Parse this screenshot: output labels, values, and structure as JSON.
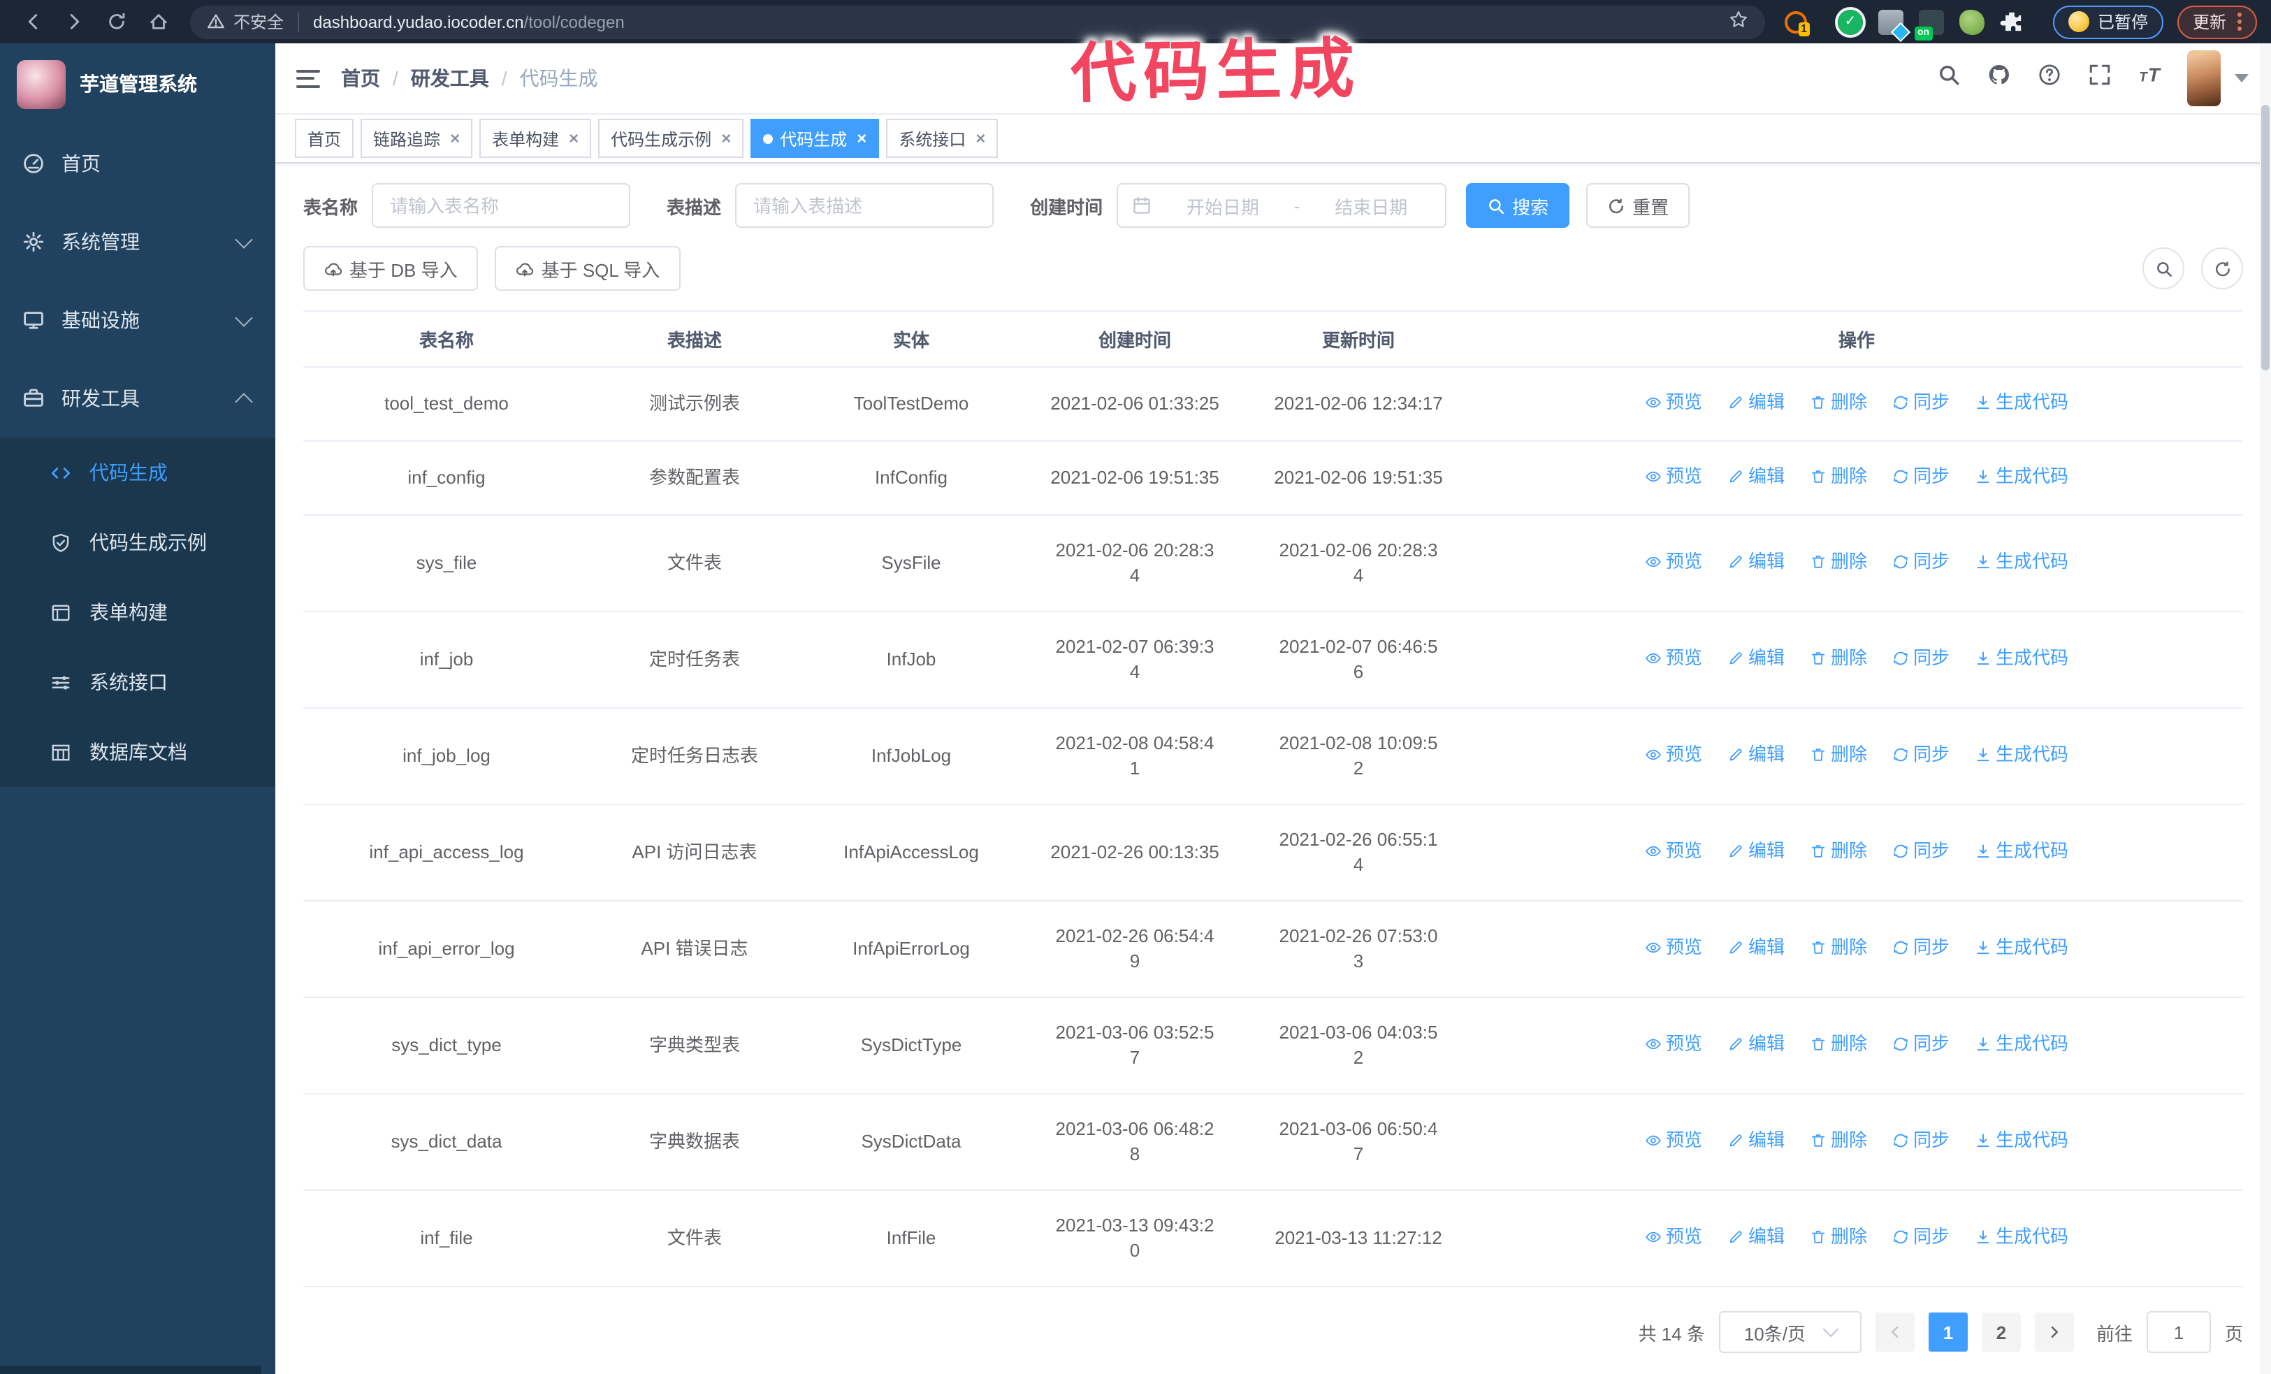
{
  "browser": {
    "security_warning": "不安全",
    "url_host": "dashboard.yudao.iocoder.cn",
    "url_path": "/tool/codegen",
    "extension_count_badge": "1",
    "extension_on_badge": "on",
    "paused_badge_label": "已暂停",
    "update_button_label": "更新"
  },
  "annotation": {
    "text": "代码生成",
    "color": "#f2455f"
  },
  "sidebar": {
    "logo_title": "芋道管理系统",
    "menu": [
      {
        "label": "首页",
        "icon": "dashboard",
        "arrow": null,
        "active": false
      },
      {
        "label": "系统管理",
        "icon": "gear",
        "arrow": "down",
        "active": false
      },
      {
        "label": "基础设施",
        "icon": "monitor",
        "arrow": "down",
        "active": false
      },
      {
        "label": "研发工具",
        "icon": "briefcase",
        "arrow": "up",
        "active": false
      }
    ],
    "submenu": [
      {
        "label": "代码生成",
        "icon": "code",
        "active": true
      },
      {
        "label": "代码生成示例",
        "icon": "shield-check",
        "active": false
      },
      {
        "label": "表单构建",
        "icon": "form",
        "active": false
      },
      {
        "label": "系统接口",
        "icon": "sliders",
        "active": false
      },
      {
        "label": "数据库文档",
        "icon": "db-grid",
        "active": false
      }
    ]
  },
  "navbar": {
    "breadcrumb": [
      {
        "label": "首页",
        "current": false
      },
      {
        "label": "研发工具",
        "current": false
      },
      {
        "label": "代码生成",
        "current": true
      }
    ],
    "right_icons": [
      "search",
      "github",
      "question",
      "fullscreen",
      "text-size"
    ]
  },
  "tabs": [
    {
      "label": "首页",
      "closable": false,
      "active": false
    },
    {
      "label": "链路追踪",
      "closable": true,
      "active": false
    },
    {
      "label": "表单构建",
      "closable": true,
      "active": false
    },
    {
      "label": "代码生成示例",
      "closable": true,
      "active": false
    },
    {
      "label": "代码生成",
      "closable": true,
      "active": true
    },
    {
      "label": "系统接口",
      "closable": true,
      "active": false
    }
  ],
  "filters": {
    "name_label": "表名称",
    "name_placeholder": "请输入表名称",
    "desc_label": "表描述",
    "desc_placeholder": "请输入表描述",
    "time_label": "创建时间",
    "start_placeholder": "开始日期",
    "separator": "-",
    "end_placeholder": "结束日期",
    "search_button": "搜索",
    "reset_button": "重置"
  },
  "actions_bar": {
    "import_db_button": "基于 DB 导入",
    "import_sql_button": "基于 SQL 导入"
  },
  "table": {
    "columns": [
      "表名称",
      "表描述",
      "实体",
      "创建时间",
      "更新时间",
      "操作"
    ],
    "row_actions": [
      {
        "label": "预览",
        "icon": "eye"
      },
      {
        "label": "编辑",
        "icon": "edit"
      },
      {
        "label": "删除",
        "icon": "trash"
      },
      {
        "label": "同步",
        "icon": "sync"
      },
      {
        "label": "生成代码",
        "icon": "download"
      }
    ],
    "rows": [
      {
        "name": "tool_test_demo",
        "desc": "测试示例表",
        "entity": "ToolTestDemo",
        "created": "2021-02-06 01:33:25",
        "updated": "2021-02-06 12:34:17"
      },
      {
        "name": "inf_config",
        "desc": "参数配置表",
        "entity": "InfConfig",
        "created": "2021-02-06 19:51:35",
        "updated": "2021-02-06 19:51:35"
      },
      {
        "name": "sys_file",
        "desc": "文件表",
        "entity": "SysFile",
        "created": "2021-02-06 20:28:3\n4",
        "updated": "2021-02-06 20:28:3\n4"
      },
      {
        "name": "inf_job",
        "desc": "定时任务表",
        "entity": "InfJob",
        "created": "2021-02-07 06:39:3\n4",
        "updated": "2021-02-07 06:46:5\n6"
      },
      {
        "name": "inf_job_log",
        "desc": "定时任务日志表",
        "entity": "InfJobLog",
        "created": "2021-02-08 04:58:4\n1",
        "updated": "2021-02-08 10:09:5\n2"
      },
      {
        "name": "inf_api_access_log",
        "desc": "API 访问日志表",
        "entity": "InfApiAccessLog",
        "created": "2021-02-26 00:13:35",
        "updated": "2021-02-26 06:55:1\n4"
      },
      {
        "name": "inf_api_error_log",
        "desc": "API 错误日志",
        "entity": "InfApiErrorLog",
        "created": "2021-02-26 06:54:4\n9",
        "updated": "2021-02-26 07:53:0\n3"
      },
      {
        "name": "sys_dict_type",
        "desc": "字典类型表",
        "entity": "SysDictType",
        "created": "2021-03-06 03:52:5\n7",
        "updated": "2021-03-06 04:03:5\n2"
      },
      {
        "name": "sys_dict_data",
        "desc": "字典数据表",
        "entity": "SysDictData",
        "created": "2021-03-06 06:48:2\n8",
        "updated": "2021-03-06 06:50:4\n7"
      },
      {
        "name": "inf_file",
        "desc": "文件表",
        "entity": "InfFile",
        "created": "2021-03-13 09:43:2\n0",
        "updated": "2021-03-13 11:27:12"
      }
    ]
  },
  "pagination": {
    "total": "共 14 条",
    "page_size": "10条/页",
    "pages": [
      "1",
      "2"
    ],
    "active_page": "1",
    "goto_label": "前往",
    "goto_value": "1",
    "goto_suffix": "页"
  },
  "colors": {
    "primary": "#409eff",
    "sidebar_bg": "#20425f",
    "submenu_bg": "#1a374e"
  }
}
